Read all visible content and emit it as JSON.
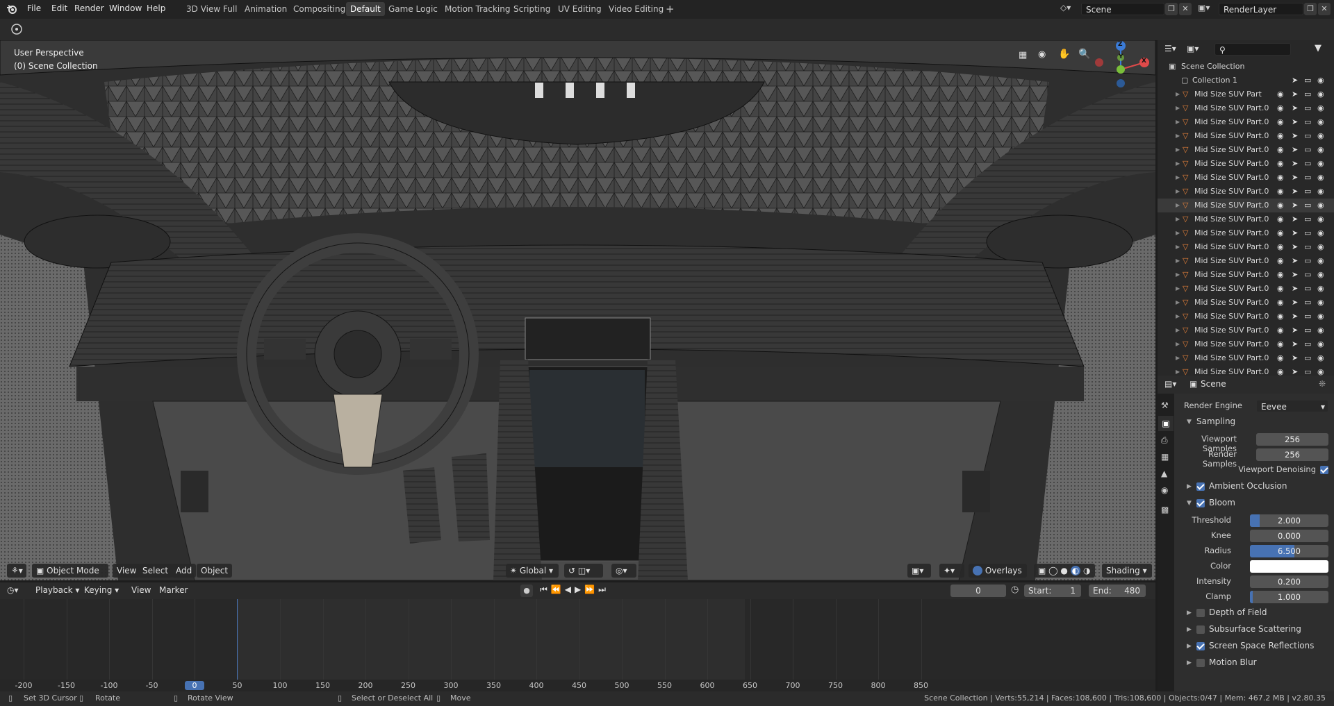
{
  "menu": {
    "file": "File",
    "edit": "Edit",
    "render": "Render",
    "window": "Window",
    "help": "Help"
  },
  "workspaces": [
    {
      "label": "3D View Full"
    },
    {
      "label": "Animation"
    },
    {
      "label": "Compositing"
    },
    {
      "label": "Default"
    },
    {
      "label": "Game Logic"
    },
    {
      "label": "Motion Tracking"
    },
    {
      "label": "Scripting"
    },
    {
      "label": "UV Editing"
    },
    {
      "label": "Video Editing"
    }
  ],
  "active_workspace": "Default",
  "scene_field": "Scene",
  "renderlayer_field": "RenderLayer",
  "viewport": {
    "perspective": "User Perspective",
    "collection": "(0) Scene Collection",
    "mode": "Object Mode",
    "menus": {
      "view": "View",
      "select": "Select",
      "add": "Add",
      "object": "Object"
    },
    "orientation": "Global",
    "overlays": "Overlays",
    "shading": "Shading",
    "axes": {
      "z": "Z",
      "y": "Y",
      "x": "X"
    }
  },
  "timeline": {
    "playback": "Playback",
    "keying": "Keying",
    "view": "View",
    "marker": "Marker",
    "current_frame": "0",
    "start_label": "Start:",
    "start": "1",
    "end_label": "End:",
    "end": "480",
    "ruler": [
      "-200",
      "-150",
      "-100",
      "-50",
      "0",
      "50",
      "100",
      "150",
      "200",
      "250",
      "300",
      "350",
      "400",
      "450",
      "500",
      "550",
      "600",
      "650",
      "700",
      "750",
      "800",
      "850"
    ]
  },
  "outliner": {
    "root": "Scene Collection",
    "collection": "Collection 1",
    "items": [
      "Mid Size SUV Part",
      "Mid Size SUV Part.0",
      "Mid Size SUV Part.0",
      "Mid Size SUV Part.0",
      "Mid Size SUV Part.0",
      "Mid Size SUV Part.0",
      "Mid Size SUV Part.0",
      "Mid Size SUV Part.0",
      "Mid Size SUV Part.0",
      "Mid Size SUV Part.0",
      "Mid Size SUV Part.0",
      "Mid Size SUV Part.0",
      "Mid Size SUV Part.0",
      "Mid Size SUV Part.0",
      "Mid Size SUV Part.0",
      "Mid Size SUV Part.0",
      "Mid Size SUV Part.0",
      "Mid Size SUV Part.0",
      "Mid Size SUV Part.0",
      "Mid Size SUV Part.0",
      "Mid Size SUV Part.0"
    ],
    "selected_index": 8
  },
  "properties": {
    "context": "Scene",
    "render_engine_label": "Render Engine",
    "render_engine": "Eevee",
    "sampling": "Sampling",
    "viewport_samples_label": "Viewport Samples",
    "viewport_samples": "256",
    "render_samples_label": "Render Samples",
    "render_samples": "256",
    "viewport_denoising": "Viewport Denoising",
    "ambient_occlusion": "Ambient Occlusion",
    "bloom": "Bloom",
    "threshold_label": "Threshold",
    "threshold": "2.000",
    "knee_label": "Knee",
    "knee": "0.000",
    "radius_label": "Radius",
    "radius": "6.500",
    "color_label": "Color",
    "intensity_label": "Intensity",
    "intensity": "0.200",
    "clamp_label": "Clamp",
    "clamp": "1.000",
    "depth_of_field": "Depth of Field",
    "subsurface_scattering": "Subsurface Scattering",
    "screen_space_reflections": "Screen Space Reflections",
    "motion_blur": "Motion Blur"
  },
  "status": {
    "set_cursor": "Set 3D Cursor",
    "rotate": "Rotate",
    "rotate_view": "Rotate View",
    "select_deselect": "Select or Deselect All",
    "move": "Move",
    "stats": "Scene Collection | Verts:55,214 | Faces:108,600 | Tris:108,600 | Objects:0/47 | Mem: 467.2 MB | v2.80.35"
  },
  "colors": {
    "accent": "#4772b3",
    "topbar": "#232323",
    "panel": "#2e2e2e",
    "mesh_icon": "#e8823a"
  }
}
